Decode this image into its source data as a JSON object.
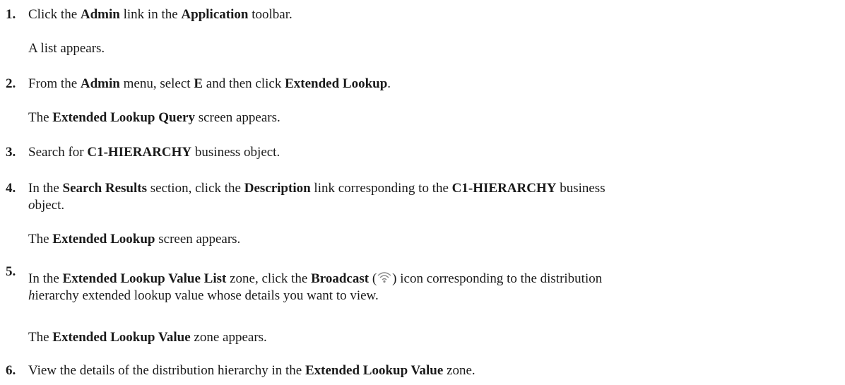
{
  "steps": [
    {
      "number": "1.",
      "parts": [
        "Click the ",
        "Admin",
        " link in the ",
        "Application",
        " toolbar."
      ],
      "result": "A list appears."
    },
    {
      "number": "2.",
      "parts": [
        "From the ",
        "Admin",
        " menu, select ",
        "E",
        " and then click ",
        "Extended Lookup",
        "."
      ],
      "result_parts": [
        "The ",
        "Extended Lookup Query",
        " screen appears."
      ]
    },
    {
      "number": "3.",
      "parts": [
        "Search for ",
        "C1-HIERARCHY",
        " business object."
      ]
    },
    {
      "number": "4.",
      "parts": [
        "In the ",
        "Search Results",
        " section, click the ",
        "Description",
        " link corresponding to the ",
        "C1-HIERARCHY",
        " business"
      ],
      "line2_italic": "o",
      "line2_rest": "bject.",
      "result_parts": [
        "The ",
        "Extended Lookup",
        " screen appears."
      ]
    },
    {
      "number": "5.",
      "parts": [
        "In the ",
        "Extended Lookup Value List",
        " zone, click the ",
        "Broadcast",
        " (",
        ") icon corresponding to the distribution"
      ],
      "line2_italic": "h",
      "line2_rest": "ierarchy extended lookup value whose details you want to view.",
      "icon": "broadcast-icon",
      "result_parts": [
        "The ",
        "Extended Lookup Value",
        " zone appears."
      ]
    },
    {
      "number": "6.",
      "parts": [
        "View the details of the distribution hierarchy in the ",
        "Extended Lookup Value",
        " zone."
      ]
    }
  ]
}
